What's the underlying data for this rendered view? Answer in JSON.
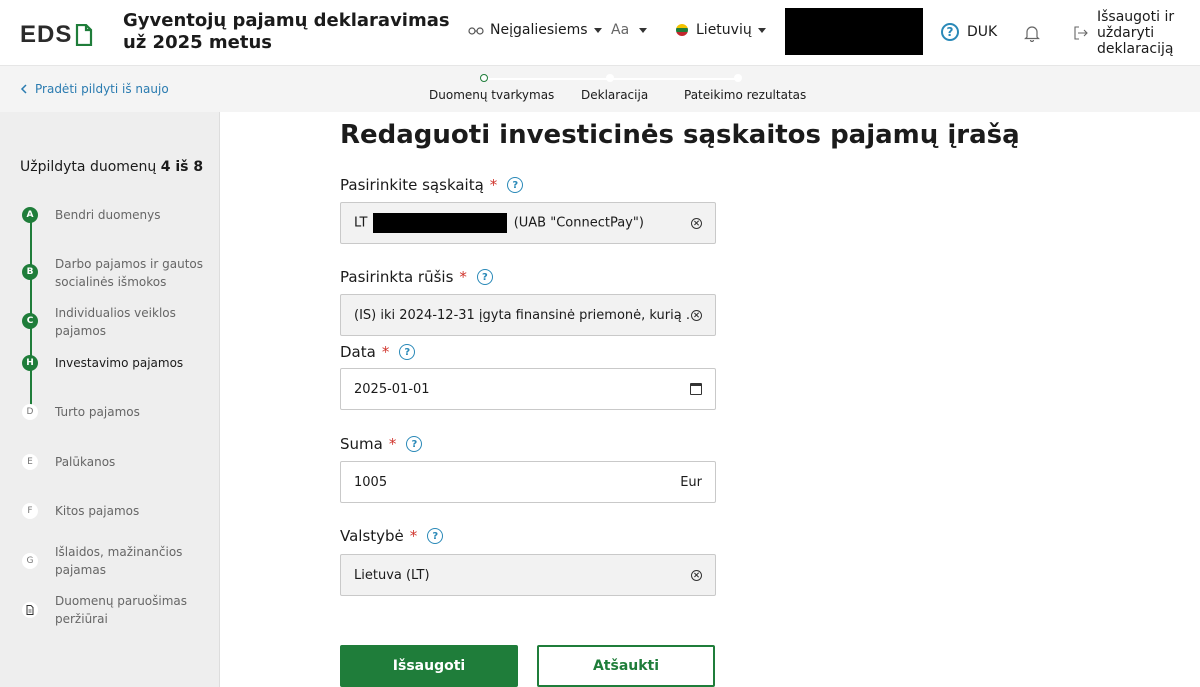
{
  "header": {
    "logo_text": "EDS",
    "title": "Gyventojų pajamų deklaravimas už 2025 metus",
    "accessibility_label": "Neįgaliesiems",
    "font_size_label": "Aa",
    "language_label": "Lietuvių",
    "faq_label": "DUK",
    "save_exit_label": "Išsaugoti ir uždaryti deklaraciją"
  },
  "subbar": {
    "back_label": "Pradėti pildyti iš naujo",
    "steps": [
      {
        "label": "Duomenų tvarkymas",
        "state": "current"
      },
      {
        "label": "Deklaracija",
        "state": "todo"
      },
      {
        "label": "Pateikimo rezultatas",
        "state": "todo"
      }
    ]
  },
  "sidebar": {
    "progress_prefix": "Užpildyta duomenų",
    "progress_count": "4 iš 8",
    "items": [
      {
        "badge": "A",
        "label": "Bendri duomenys",
        "done": true
      },
      {
        "badge": "B",
        "label": "Darbo pajamos ir gautos socialinės išmokos",
        "done": true
      },
      {
        "badge": "C",
        "label": "Individualios veiklos pajamos",
        "done": true
      },
      {
        "badge": "H",
        "label": "Investavimo pajamos",
        "done": true,
        "active": true
      },
      {
        "badge": "D",
        "label": "Turto pajamos",
        "done": false
      },
      {
        "badge": "E",
        "label": "Palūkanos",
        "done": false
      },
      {
        "badge": "F",
        "label": "Kitos pajamos",
        "done": false
      },
      {
        "badge": "G",
        "label": "Išlaidos, mažinančios pajamas",
        "done": false
      },
      {
        "badge": "",
        "label": "Duomenų paruošimas peržiūrai",
        "done": false
      }
    ]
  },
  "form": {
    "title": "Redaguoti investicinės sąskaitos pajamų įrašą",
    "account": {
      "label": "Pasirinkite sąskaitą",
      "value_prefix": "LT",
      "value_suffix": "(UAB \"ConnectPay\")"
    },
    "type": {
      "label": "Pasirinkta rūšis",
      "value": "(IS) iki 2024-12-31 įgyta finansinė priemonė, kurią ..."
    },
    "date": {
      "label": "Data",
      "value": "2025-01-01"
    },
    "amount": {
      "label": "Suma",
      "value": "1005",
      "unit": "Eur"
    },
    "country": {
      "label": "Valstybė",
      "value": "Lietuva (LT)"
    },
    "save_button": "Išsaugoti",
    "cancel_button": "Atšaukti"
  },
  "colors": {
    "brand_green": "#1f7d3a",
    "link_blue": "#2a7bb0",
    "required_red": "#d0342c"
  }
}
